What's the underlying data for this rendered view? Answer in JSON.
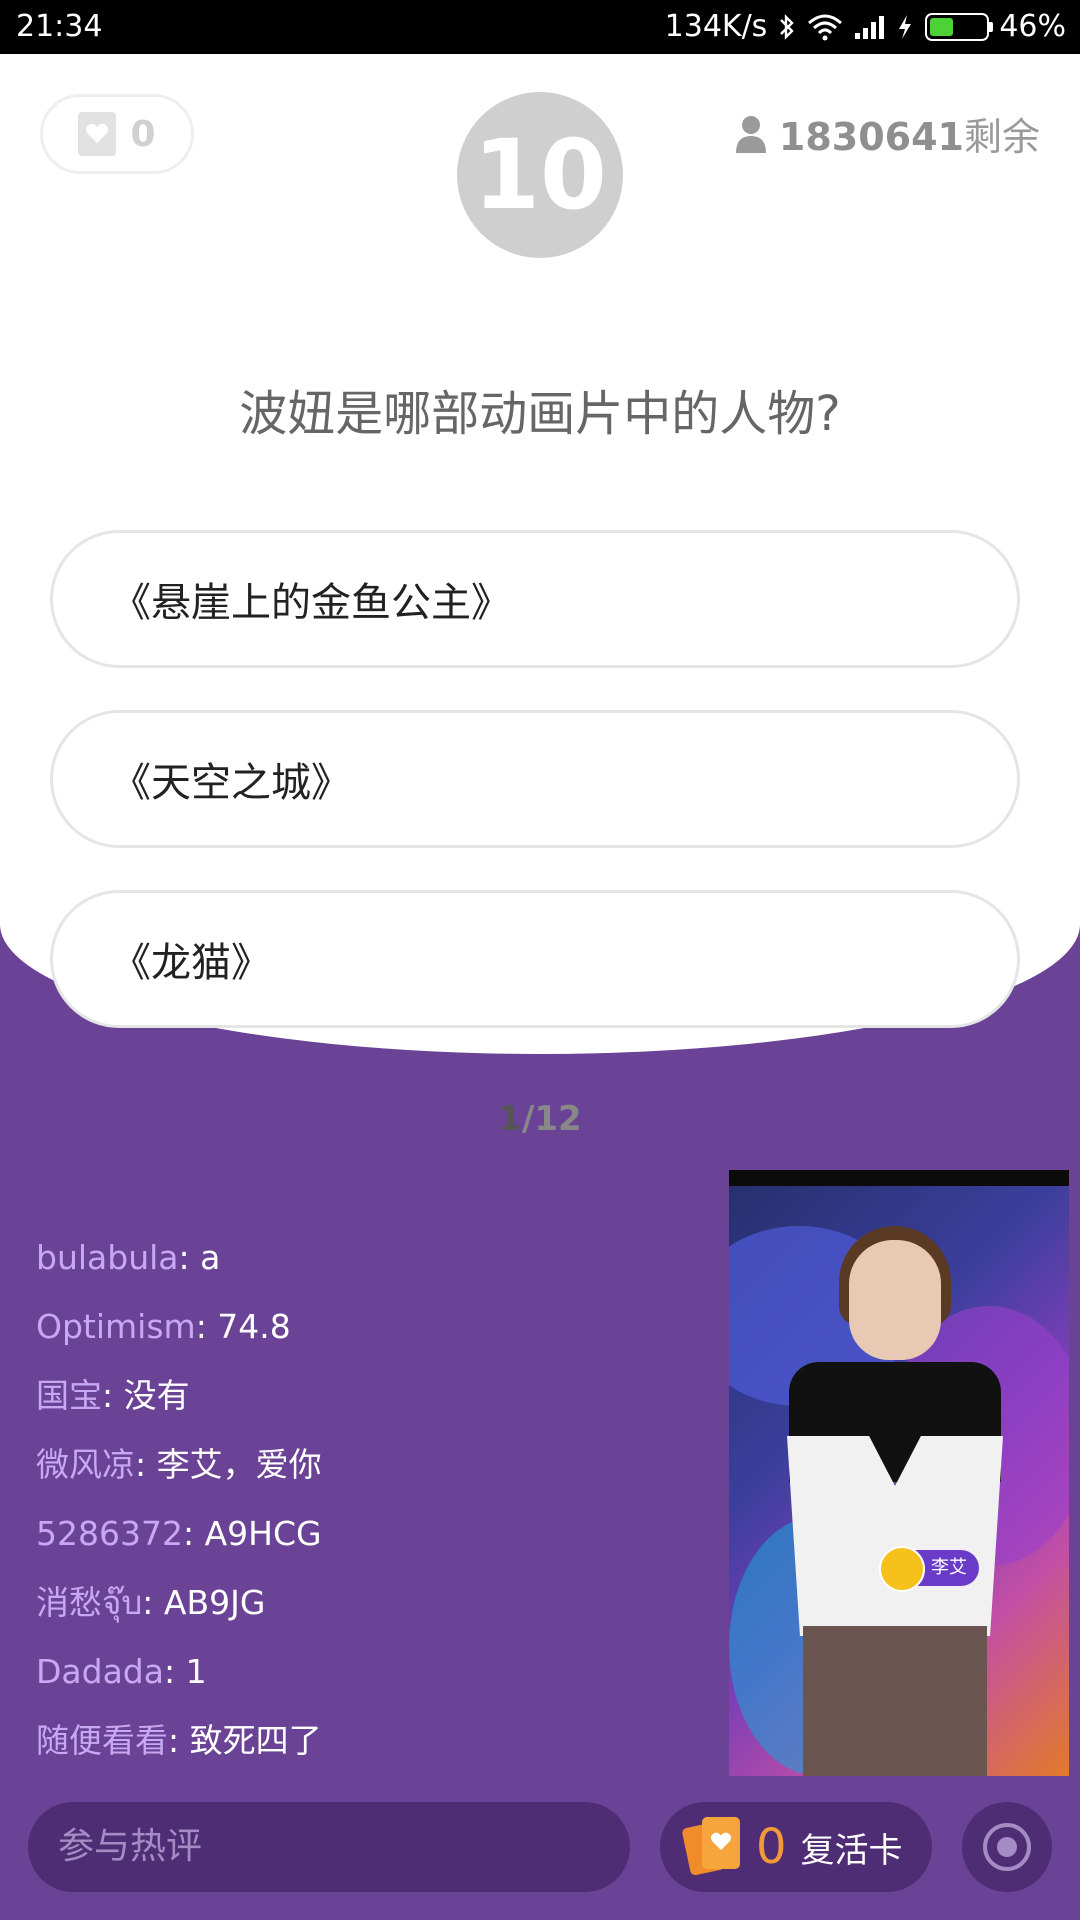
{
  "status_bar": {
    "time": "21:34",
    "speed": "134K/s",
    "battery": "46%",
    "battery_level": 0.46
  },
  "quiz": {
    "lives_count": "0",
    "timer": "10",
    "remaining_count": "1830641",
    "remaining_label": "剩余",
    "question": "波妞是哪部动画片中的人物?",
    "options": [
      "《悬崖上的金鱼公主》",
      "《天空之城》",
      "《龙猫》"
    ],
    "progress_current": "1",
    "progress_total": "/12"
  },
  "chat": [
    {
      "user": "bulabula",
      "text": ": a"
    },
    {
      "user": "Optimism",
      "text": ": 74.8"
    },
    {
      "user": "国宝",
      "text": ": 没有"
    },
    {
      "user": "微风凉",
      "text": ": 李艾，爱你"
    },
    {
      "user": "5286372",
      "text": ": A9HCG"
    },
    {
      "user": "消愁จุ๊บ",
      "text": ": AB9JG"
    },
    {
      "user": "Dadada",
      "text": ": 1"
    },
    {
      "user": "随便看看",
      "text": ": 致死四了"
    }
  ],
  "video": {
    "host_badge": "李艾"
  },
  "bottom_bar": {
    "comment_placeholder": "参与热评",
    "revive_count": "0",
    "revive_label": "复活卡"
  },
  "colors": {
    "background": "#6b4396",
    "input_bg": "#4e2d74",
    "username": "#c9a8f2",
    "revive_accent": "#f29a3a"
  }
}
